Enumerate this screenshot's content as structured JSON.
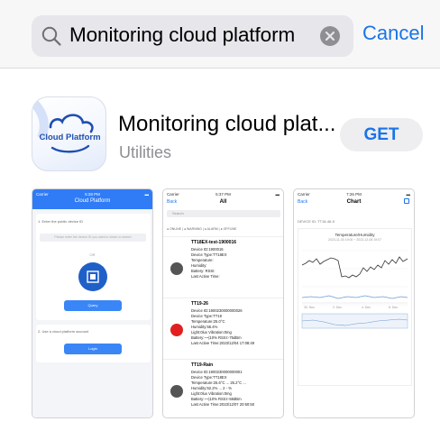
{
  "search": {
    "query": "Monitoring cloud platform",
    "cancel_label": "Cancel"
  },
  "app": {
    "name": "Monitoring cloud plat...",
    "category": "Utilities",
    "get_label": "GET",
    "icon_text": "Cloud Platform"
  },
  "screenshots": {
    "shot1": {
      "status_carrier": "Carrier",
      "status_time": "5:28 PM",
      "title": "Cloud Platform",
      "section1": "1. Enter the public device ID",
      "input_placeholder": "Please enter the device ID you want to share or search",
      "or_label": "OR",
      "query_button": "Query",
      "section2": "2. Use a cloud platform account",
      "login_button": "Login"
    },
    "shot2": {
      "status_carrier": "Carrier",
      "status_time": "5:37 PM",
      "back": "Back",
      "title": "All",
      "search_placeholder": "Search",
      "legend": "● ONLINE | ● WARNING | ● ALARM | ● OFFLINE",
      "devices": [
        {
          "name": "TT18EX-test-1900016",
          "id_label": "Device ID:",
          "id": "1900016",
          "type_label": "Device Type:",
          "type": "TT18EX",
          "temp_label": "Temperature:",
          "temp": "",
          "hum_label": "Humidity:",
          "hum": "",
          "batt_label": "Battery:",
          "batt": "",
          "rssi_label": "RSSI:",
          "rssi": "",
          "active_label": "Last Active Time:",
          "active": "",
          "status_color": "#555555"
        },
        {
          "name": "TT19-26",
          "id_label": "Device ID:",
          "id": "1900230000000026",
          "type_label": "Device Type:",
          "type": "TT19",
          "temp_label": "Temperature:",
          "temp": "25.0°C",
          "hum_label": "Humidity:",
          "hum": "56.4%",
          "extra": "Light:0lux  Vibration:0mg",
          "batt_label": "Battery:",
          "batt": "~~|10%",
          "rssi_label": "RSSI:",
          "rssi": "-75dBm",
          "active_label": "Last Active Time:",
          "active": "2023/12/04 17:08:49",
          "status_color": "#e02020"
        },
        {
          "name": "TT19-Rain",
          "id_label": "Device ID:",
          "id": "1900230000000001",
          "type_label": "Device Type:",
          "type": "TT18EX",
          "temp_label": "Temperature:",
          "temp": "25.6°C ... 25.2°C ...",
          "hum_label": "Humidity:",
          "hum": "52.2% ... 2 - %",
          "extra": "Light:0lux  Vibration:0mg",
          "batt_label": "Battery:",
          "batt": "~~|10%",
          "rssi_label": "RSSI:",
          "rssi": "-59dBm",
          "active_label": "Last Active Time:",
          "active": "2023/12/07 20:50:50",
          "status_color": "#555555"
        }
      ]
    },
    "shot3": {
      "status_carrier": "Carrier",
      "status_time": "7:26 PM",
      "back": "Back",
      "title": "Chart",
      "device_id": "DEVICE ID: TT18-46-5",
      "chart_title": "Temperature/Humidity",
      "chart_subtitle": "2023-11-30 19:00 ~ 2023-12-08 19:07",
      "x_ticks": [
        "30. Nov",
        "2. Dec",
        "4. Dec",
        "6. Dec"
      ]
    }
  },
  "colors": {
    "accent": "#1a74e8",
    "alarm": "#e02020",
    "offline": "#555555",
    "platform_blue": "#2f7cf6"
  }
}
